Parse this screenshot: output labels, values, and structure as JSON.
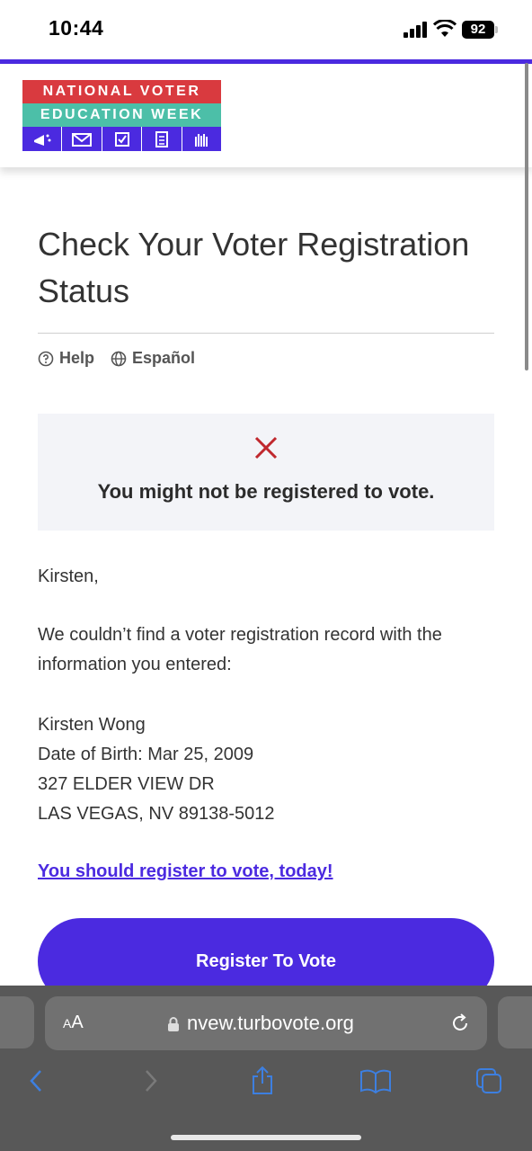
{
  "status_bar": {
    "time": "10:44",
    "battery": "92"
  },
  "logo": {
    "line1": "NATIONAL VOTER",
    "line2": "EDUCATION WEEK"
  },
  "page": {
    "title": "Check Your Voter Registration Status",
    "help_label": "Help",
    "spanish_label": "Español"
  },
  "status_box": {
    "message": "You might not be registered to vote."
  },
  "body": {
    "greeting": "Kirsten,",
    "message": "We couldn’t find a voter registration record with the information you entered:",
    "name": "Kirsten Wong",
    "dob": "Date of Birth: Mar 25, 2009",
    "street": "327 ELDER VIEW DR",
    "city": "LAS VEGAS, NV 89138-5012",
    "register_link": "You should register to vote, today!",
    "register_button": "Register To Vote"
  },
  "browser": {
    "aa_label_big": "A",
    "aa_label_small": "A",
    "url": "nvew.turbovote.org"
  },
  "colors": {
    "brand_purple": "#4b2ae0",
    "logo_red": "#d93a3f",
    "logo_teal": "#4cbfa8",
    "error_red": "#c0282e"
  }
}
